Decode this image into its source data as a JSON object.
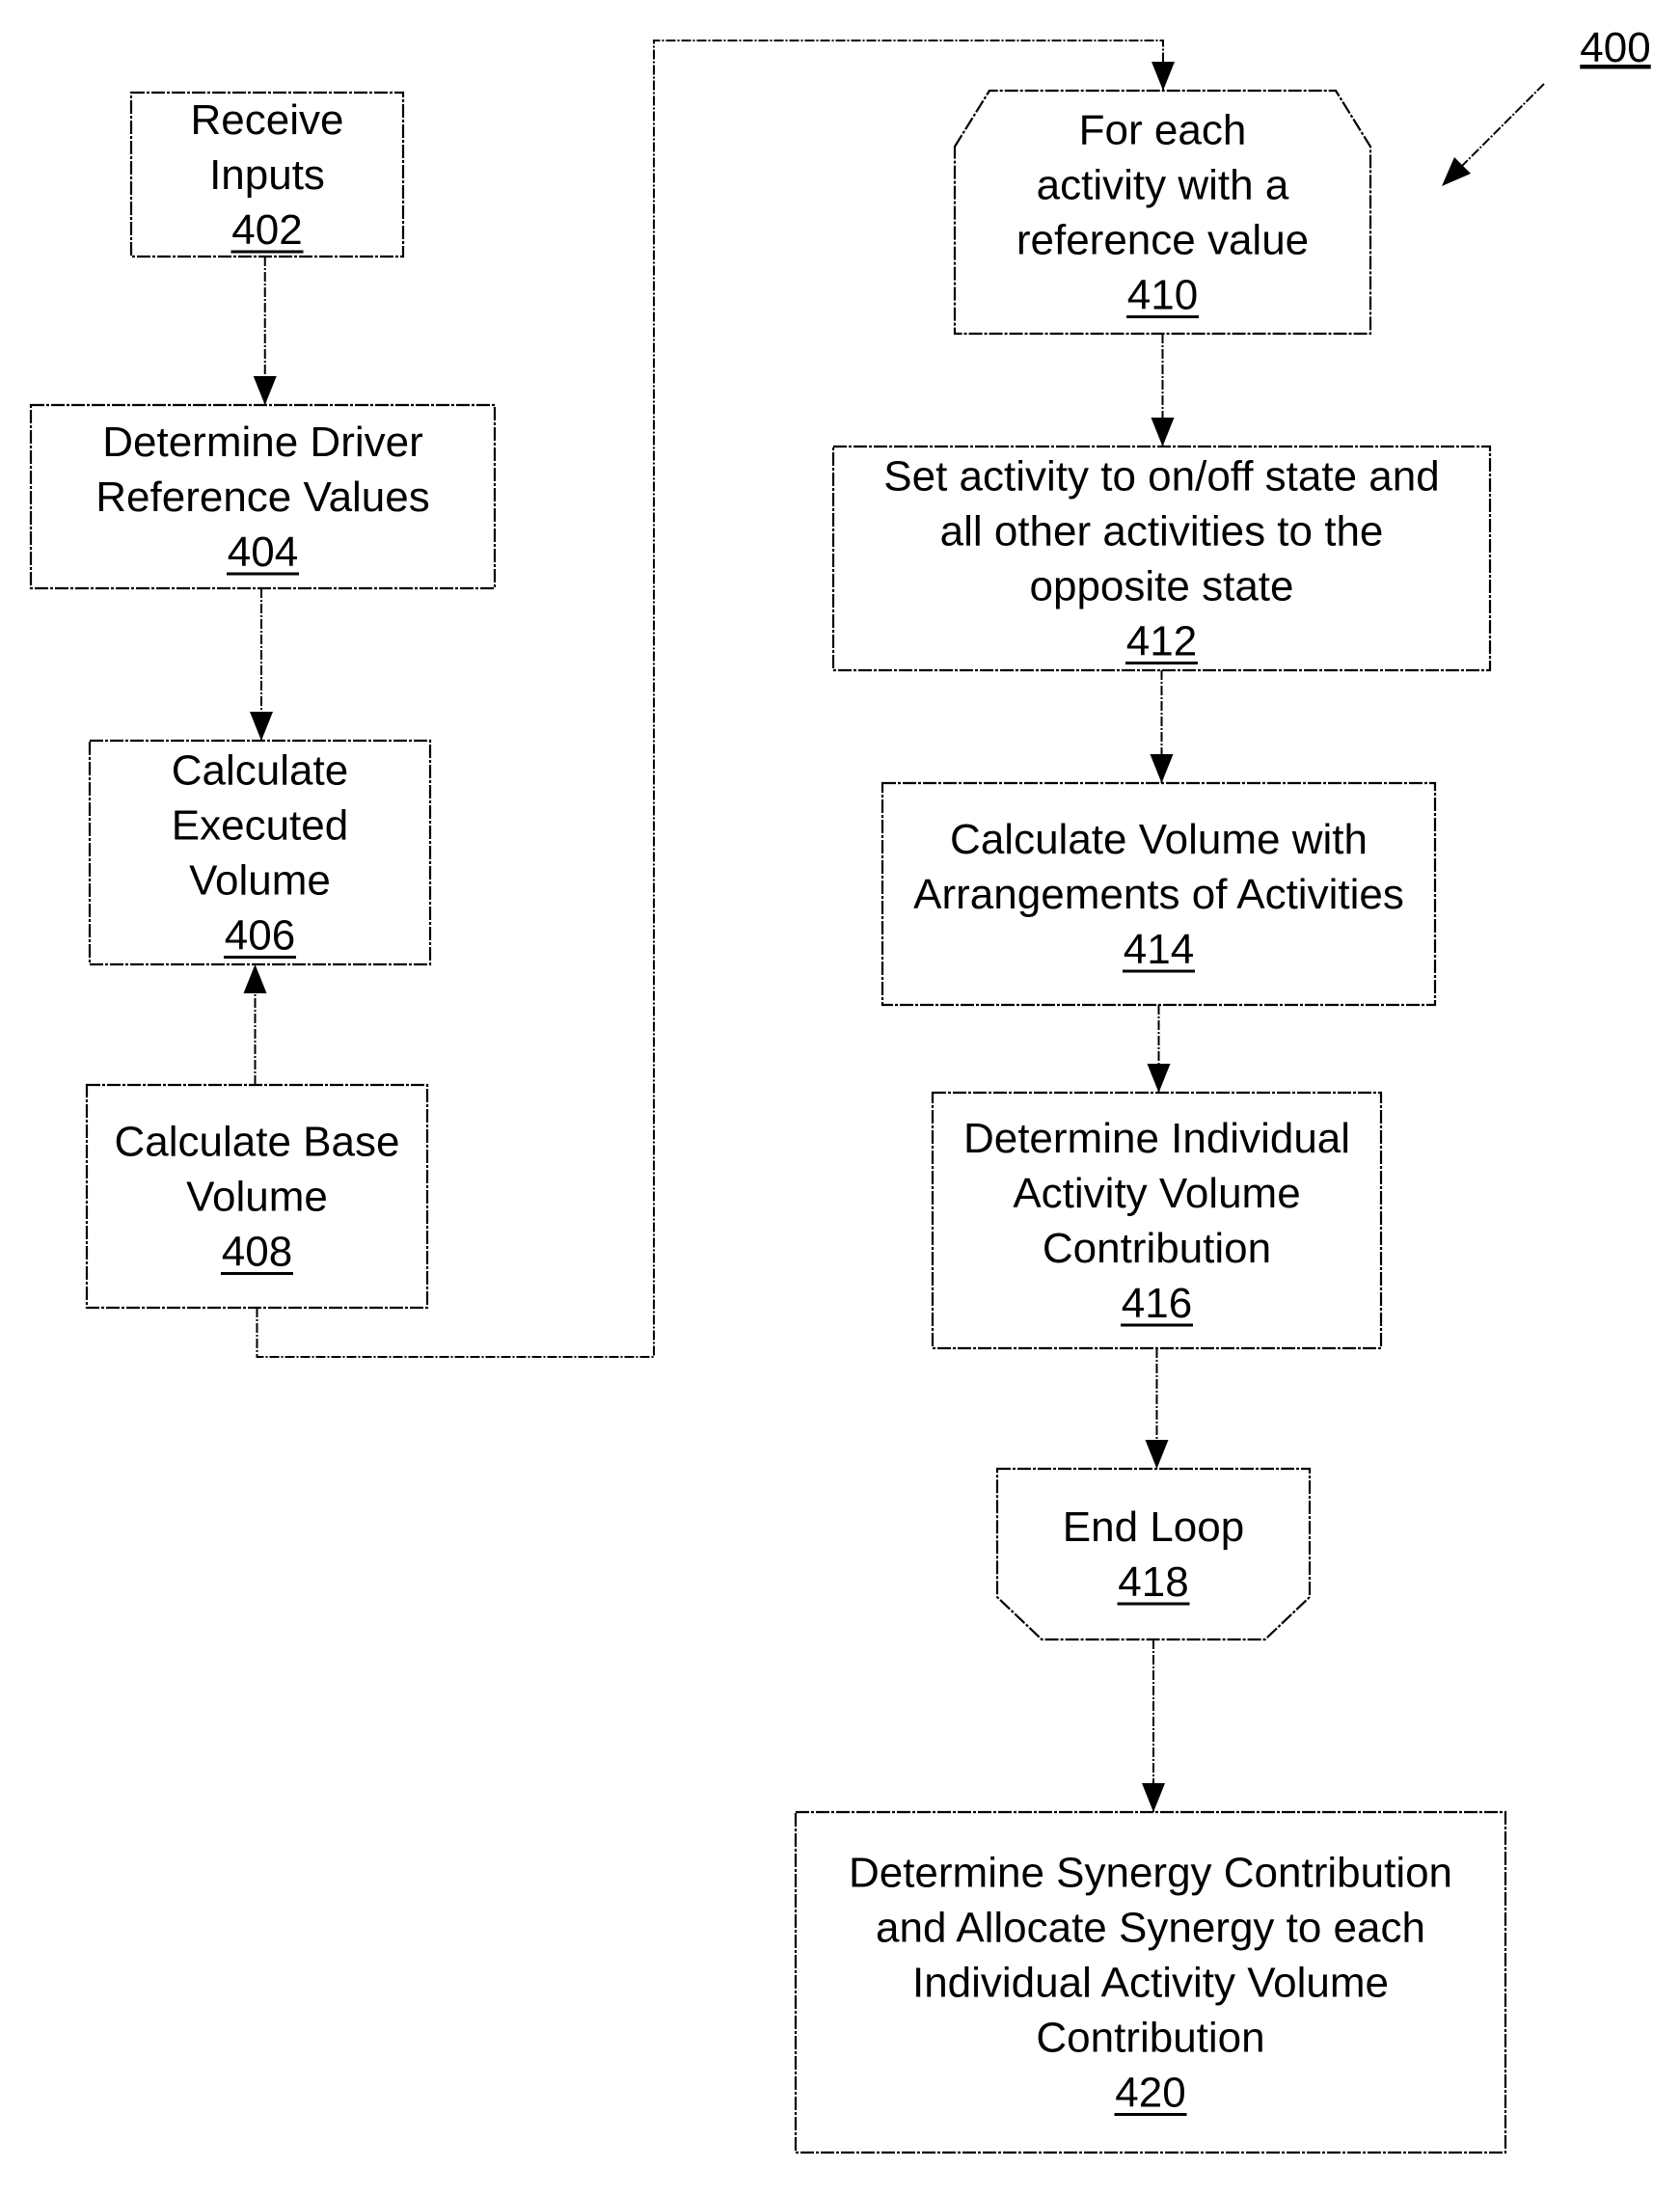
{
  "figure": {
    "ref": "400"
  },
  "steps": [
    {
      "id": "402",
      "lines": [
        "Receive",
        "Inputs"
      ],
      "shape": "rect"
    },
    {
      "id": "404",
      "lines": [
        "Determine Driver",
        "Reference Values"
      ],
      "shape": "rect"
    },
    {
      "id": "406",
      "lines": [
        "Calculate",
        "Executed",
        "Volume"
      ],
      "shape": "rect"
    },
    {
      "id": "408",
      "lines": [
        "Calculate Base",
        "Volume"
      ],
      "shape": "rect"
    },
    {
      "id": "410",
      "lines": [
        "For each",
        "activity with a",
        "reference value"
      ],
      "shape": "loop-start"
    },
    {
      "id": "412",
      "lines": [
        "Set activity to on/off state and",
        "all other activities to the",
        "opposite state"
      ],
      "shape": "rect"
    },
    {
      "id": "414",
      "lines": [
        "Calculate Volume with",
        "Arrangements of Activities"
      ],
      "shape": "rect"
    },
    {
      "id": "416",
      "lines": [
        "Determine Individual",
        "Activity Volume",
        "Contribution"
      ],
      "shape": "rect"
    },
    {
      "id": "418",
      "lines": [
        "End Loop"
      ],
      "shape": "loop-end"
    },
    {
      "id": "420",
      "lines": [
        "Determine Synergy Contribution",
        "and Allocate Synergy to each",
        "Individual Activity Volume",
        "Contribution"
      ],
      "shape": "rect"
    }
  ],
  "edges": [
    {
      "from": "402",
      "to": "404"
    },
    {
      "from": "404",
      "to": "406"
    },
    {
      "from": "408",
      "to": "406"
    },
    {
      "from": "408",
      "to": "410"
    },
    {
      "from": "410",
      "to": "412"
    },
    {
      "from": "412",
      "to": "414"
    },
    {
      "from": "414",
      "to": "416"
    },
    {
      "from": "416",
      "to": "418"
    },
    {
      "from": "418",
      "to": "420"
    }
  ]
}
